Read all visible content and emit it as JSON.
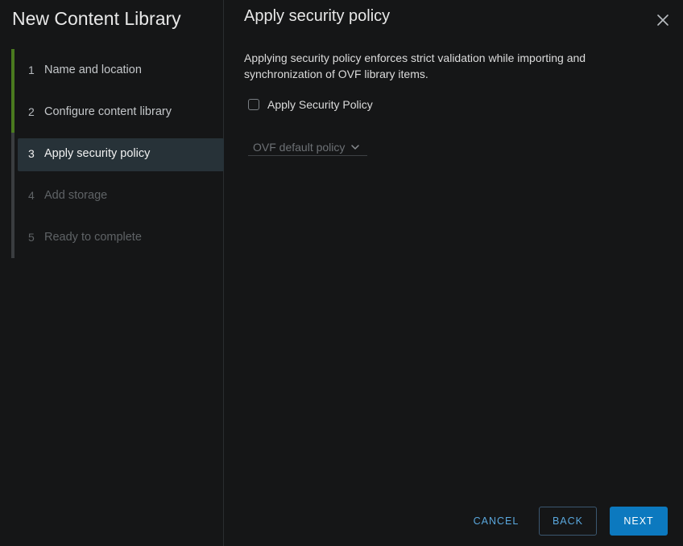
{
  "wizard": {
    "title": "New Content Library",
    "steps": [
      {
        "number": "1",
        "label": "Name and location",
        "state": "done"
      },
      {
        "number": "2",
        "label": "Configure content library",
        "state": "done"
      },
      {
        "number": "3",
        "label": "Apply security policy",
        "state": "active"
      },
      {
        "number": "4",
        "label": "Add storage",
        "state": "pending"
      },
      {
        "number": "5",
        "label": "Ready to complete",
        "state": "pending"
      }
    ]
  },
  "main": {
    "title": "Apply security policy",
    "description": "Applying security policy enforces strict validation while importing and synchronization of OVF library items.",
    "checkbox": {
      "label": "Apply Security Policy",
      "checked": false
    },
    "policy_select": {
      "value": "OVF default policy",
      "disabled": true
    }
  },
  "footer": {
    "cancel_label": "CANCEL",
    "back_label": "BACK",
    "next_label": "NEXT"
  },
  "colors": {
    "background": "#151617",
    "accent": "#0c79bf",
    "link": "#5aa8de",
    "step_done_rail": "#4a7a1f",
    "active_step_bg": "#273238"
  },
  "icons": {
    "close": "close-icon",
    "select_chevron": "chevron-down-icon"
  }
}
